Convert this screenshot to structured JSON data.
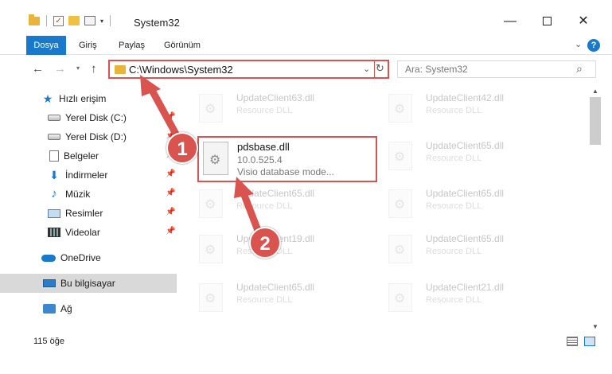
{
  "window": {
    "title": "System32",
    "minimize_glyph": "—",
    "close_glyph": "✕"
  },
  "ribbon": {
    "tabs": [
      "Dosya",
      "Giriş",
      "Paylaş",
      "Görünüm"
    ],
    "help": "?",
    "collapse": "⌄"
  },
  "navbar": {
    "back": "←",
    "forward": "→",
    "recent": "▾",
    "up": "↑",
    "address": "C:\\Windows\\System32",
    "address_drop": "⌄",
    "refresh": "↻",
    "search_placeholder": "Ara: System32",
    "search_glyph": "⌕"
  },
  "sidebar": {
    "items": [
      {
        "label": "Hızlı erişim",
        "icon": "star-icon"
      },
      {
        "label": "Yerel Disk (C:)",
        "icon": "drive-icon"
      },
      {
        "label": "Yerel Disk (D:)",
        "icon": "drive-icon"
      },
      {
        "label": "Belgeler",
        "icon": "documents-icon"
      },
      {
        "label": "İndirmeler",
        "icon": "downloads-icon"
      },
      {
        "label": "Müzik",
        "icon": "music-icon"
      },
      {
        "label": "Resimler",
        "icon": "pictures-icon"
      },
      {
        "label": "Videolar",
        "icon": "videos-icon"
      },
      {
        "label": "OneDrive",
        "icon": "cloud-icon"
      },
      {
        "label": "Bu bilgisayar",
        "icon": "computer-icon"
      },
      {
        "label": "Ağ",
        "icon": "network-icon"
      }
    ],
    "pin_glyph": "📌"
  },
  "files": {
    "left_column": [
      {
        "name": "UpdateClient63.dll",
        "desc": "Resource DLL"
      },
      {
        "name": "UpdateClient65.dll",
        "desc": "Resource DLL"
      },
      {
        "name": "UpdateClient19.dll",
        "desc": "Resource DLL"
      },
      {
        "name": "UpdateClient65.dll",
        "desc": "Resource DLL"
      }
    ],
    "right_column": [
      {
        "name": "UpdateClient42.dll",
        "desc": "Resource DLL"
      },
      {
        "name": "UpdateClient65.dll",
        "desc": "Resource DLL"
      },
      {
        "name": "UpdateClient65.dll",
        "desc": "Resource DLL"
      },
      {
        "name": "UpdateClient65.dll",
        "desc": "Resource DLL"
      },
      {
        "name": "UpdateClient21.dll",
        "desc": "Resource DLL"
      }
    ],
    "highlighted": {
      "name": "pdsbase.dll",
      "version": "10.0.525.4",
      "desc": "Visio database mode..."
    }
  },
  "statusbar": {
    "count": "115 öğe"
  },
  "callouts": [
    "1",
    "2"
  ],
  "colors": {
    "accent": "#1979ca",
    "highlight_red": "#d9534f"
  }
}
